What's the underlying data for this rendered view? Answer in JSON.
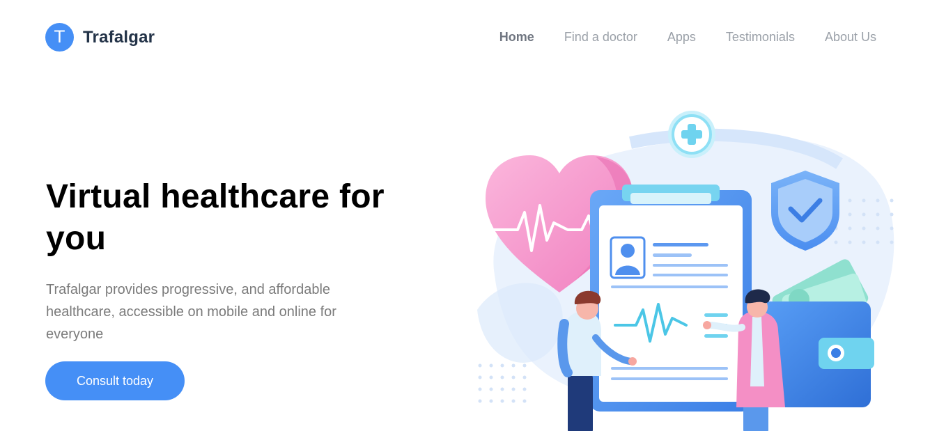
{
  "brand": {
    "logo_letter": "T",
    "name": "Trafalgar",
    "color": "#458ff6"
  },
  "nav": {
    "items": [
      {
        "label": "Home",
        "active": true
      },
      {
        "label": "Find a doctor",
        "active": false
      },
      {
        "label": "Apps",
        "active": false
      },
      {
        "label": "Testimonials",
        "active": false
      },
      {
        "label": "About Us",
        "active": false
      }
    ]
  },
  "hero": {
    "title_line1": "Virtual healthcare for",
    "title_line2": "you",
    "description": "Trafalgar provides progressive, and affordable healthcare, accessible on mobile and online for everyone",
    "cta_label": "Consult today"
  },
  "illustration": {
    "icons": [
      "heart-icon",
      "medical-cross-icon",
      "shield-check-icon",
      "wallet-icon",
      "clipboard-icon"
    ],
    "colors": {
      "primary": "#458ff6",
      "pink": "#f48fc5",
      "light": "#e8f1fd"
    }
  }
}
